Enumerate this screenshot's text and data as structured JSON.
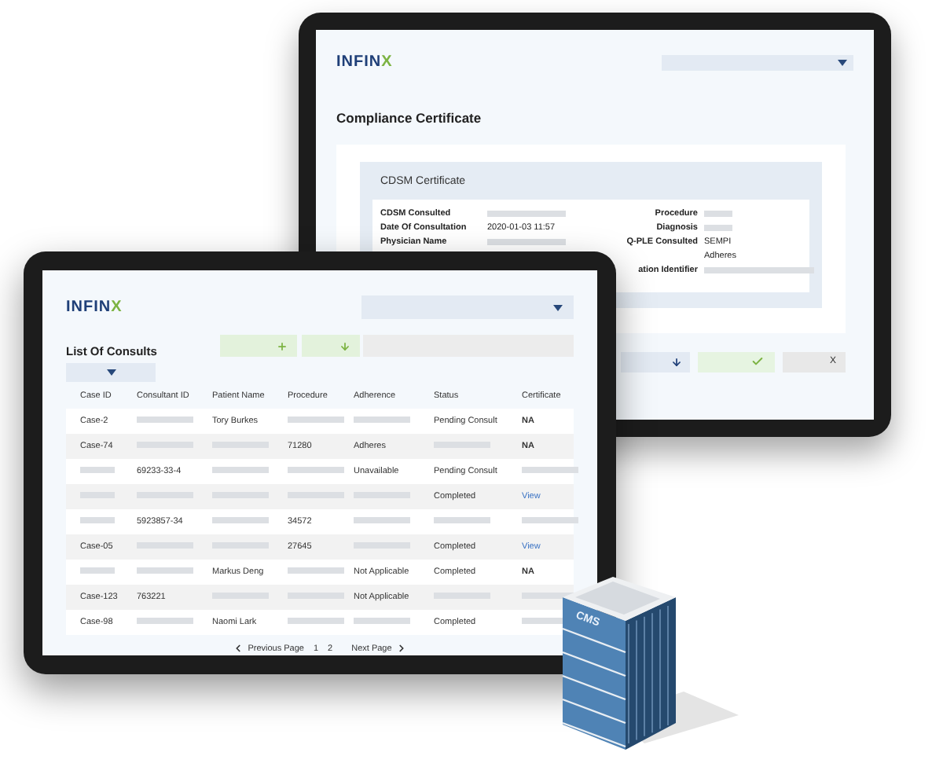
{
  "certificate_screen": {
    "logo": {
      "main": "INFIN",
      "accent": "X"
    },
    "title": "Compliance Certificate",
    "panel_title": "CDSM Certificate",
    "left_fields": [
      {
        "label": "CDSM Consulted"
      },
      {
        "label": "Date Of Consultation",
        "value": "2020-01-03 11:57"
      },
      {
        "label": "Physician Name"
      }
    ],
    "right_fields": [
      {
        "label": "Procedure"
      },
      {
        "label": "Diagnosis"
      },
      {
        "label": "Q-PLE Consulted",
        "value": "SEMPI"
      },
      {
        "value": "Adheres"
      },
      {
        "label": "ation Identifier"
      }
    ],
    "close_button": "X"
  },
  "consults_screen": {
    "logo": {
      "main": "INFIN",
      "accent": "X"
    },
    "title": "List Of Consults",
    "table": {
      "columns": [
        "Case ID",
        "Consultant ID",
        "Patient Name",
        "Procedure",
        "Adherence",
        "Status",
        "Certificate"
      ],
      "rows": [
        [
          "Case-2",
          null,
          "Tory Burkes",
          null,
          null,
          "Pending Consult",
          "NA"
        ],
        [
          "Case-74",
          null,
          null,
          "71280",
          "Adheres",
          null,
          "NA"
        ],
        [
          null,
          "69233-33-4",
          null,
          null,
          "Unavailable",
          "Pending Consult",
          null
        ],
        [
          null,
          null,
          null,
          null,
          null,
          "Completed",
          {
            "text": "View",
            "kind": "link"
          }
        ],
        [
          null,
          "5923857-34",
          null,
          "34572",
          null,
          null,
          null
        ],
        [
          "Case-05",
          null,
          null,
          "27645",
          null,
          "Completed",
          {
            "text": "View",
            "kind": "link"
          }
        ],
        [
          null,
          null,
          "Markus Deng",
          null,
          "Not Applicable",
          "Completed",
          "NA"
        ],
        [
          "Case-123",
          "763221",
          null,
          null,
          "Not Applicable",
          null,
          null
        ],
        [
          "Case-98",
          null,
          "Naomi Lark",
          null,
          null,
          "Completed",
          null
        ]
      ]
    },
    "pagination": {
      "previous": "Previous Page",
      "pages": [
        {
          "label": "1",
          "selected": false
        },
        {
          "label": "2",
          "selected": false
        }
      ],
      "next": "Next Page"
    }
  },
  "building": {
    "sign": "CMS"
  }
}
